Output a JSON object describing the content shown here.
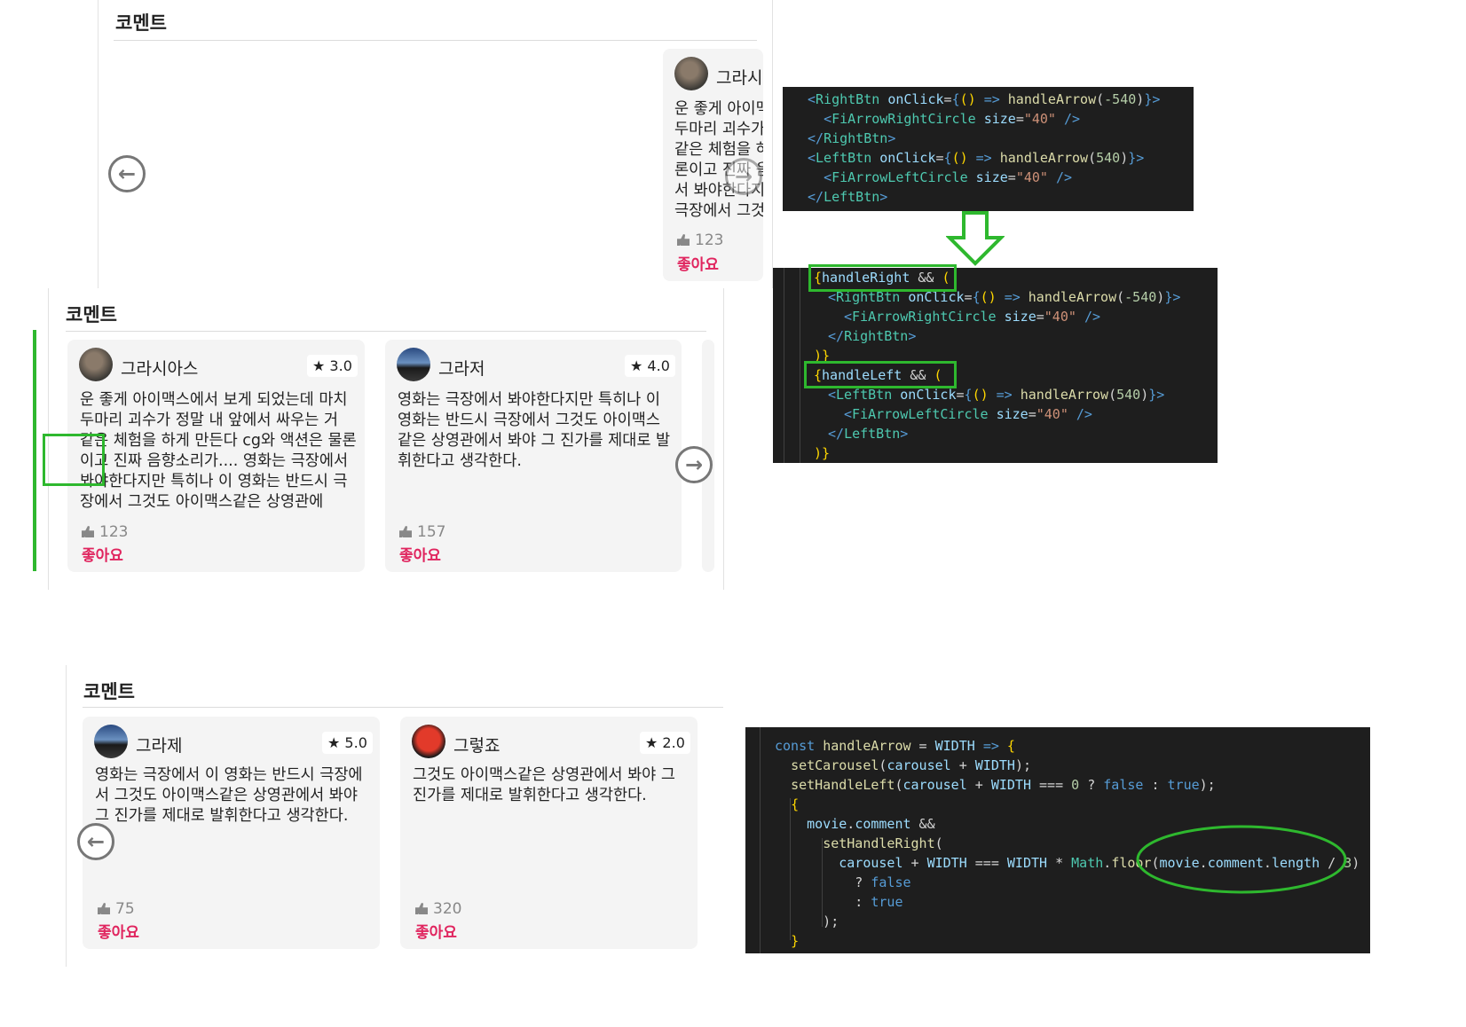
{
  "section_title": "코멘트",
  "like_label": "좋아요",
  "panel1": {
    "user": "그라시",
    "text_lines": [
      "운 좋게 아이맥",
      "두마리 괴수가",
      "같은 체험을 하",
      "론이고 진짜 음",
      "서 봐야한다지",
      "극장에서 그것"
    ],
    "likes": "123"
  },
  "panel2": {
    "cards": [
      {
        "user": "그라시아스",
        "rating": "★ 3.0",
        "text": "운 좋게 아이맥스에서 보게 되었는데 마치 두마리 괴수가 정말 내 앞에서 싸우는 거 같은 체험을 하게 만든다 cg와 액션은 물론이고 진짜 음향소리가.... 영화는 극장에서 봐야한다지만 특히나 이 영화는 반드시 극장에서 그것도 아이맥스같은 상영관에",
        "likes": "123"
      },
      {
        "user": "그라저",
        "rating": "★ 4.0",
        "text": "영화는 극장에서 봐야한다지만 특히나 이 영화는 반드시 극장에서 그것도 아이맥스같은 상영관에서 봐야 그 진가를 제대로 발휘한다고 생각한다.",
        "likes": "157"
      }
    ]
  },
  "panel3": {
    "cards": [
      {
        "user": "그라제",
        "rating": "★ 5.0",
        "text": "영화는 극장에서 이 영화는 반드시 극장에서 그것도 아이맥스같은 상영관에서 봐야 그 진가를 제대로 발휘한다고 생각한다.",
        "likes": "75"
      },
      {
        "user": "그렇죠",
        "rating": "★ 2.0",
        "text": "그것도 아이맥스같은 상영관에서 봐야 그 진가를 제대로 발휘한다고 생각한다.",
        "likes": "320"
      }
    ]
  },
  "code1": {
    "lines": [
      "<RightBtn onClick={() => handleArrow(-540)}>",
      "  <FiArrowRightCircle size=\"40\" />",
      "</RightBtn>",
      "<LeftBtn onClick={() => handleArrow(540)}>",
      "  <FiArrowLeftCircle size=\"40\" />",
      "</LeftBtn>"
    ]
  },
  "code2": {
    "lines": [
      "{handleRight && (",
      "  <RightBtn onClick={() => handleArrow(-540)}>",
      "    <FiArrowRightCircle size=\"40\" />",
      "  </RightBtn>",
      ")}",
      "{handleLeft && (",
      "  <LeftBtn onClick={() => handleArrow(540)}>",
      "    <FiArrowLeftCircle size=\"40\" />",
      "  </LeftBtn>",
      ")}"
    ]
  },
  "code3": {
    "lines": [
      "const handleArrow = WIDTH => {",
      "  setCarousel(carousel + WIDTH);",
      "  setHandleLeft(carousel + WIDTH === 0 ? false : true);",
      "  {",
      "    movie.comment &&",
      "      setHandleRight(",
      "        carousel + WIDTH === WIDTH * Math.floor(movie.comment.length / 3)",
      "          ? false",
      "          : true",
      "      );",
      "  }"
    ]
  },
  "colors": {
    "like_accent": "#e0245e",
    "annotation_green": "#2eb82e",
    "code_bg": "#1e1e1e"
  }
}
